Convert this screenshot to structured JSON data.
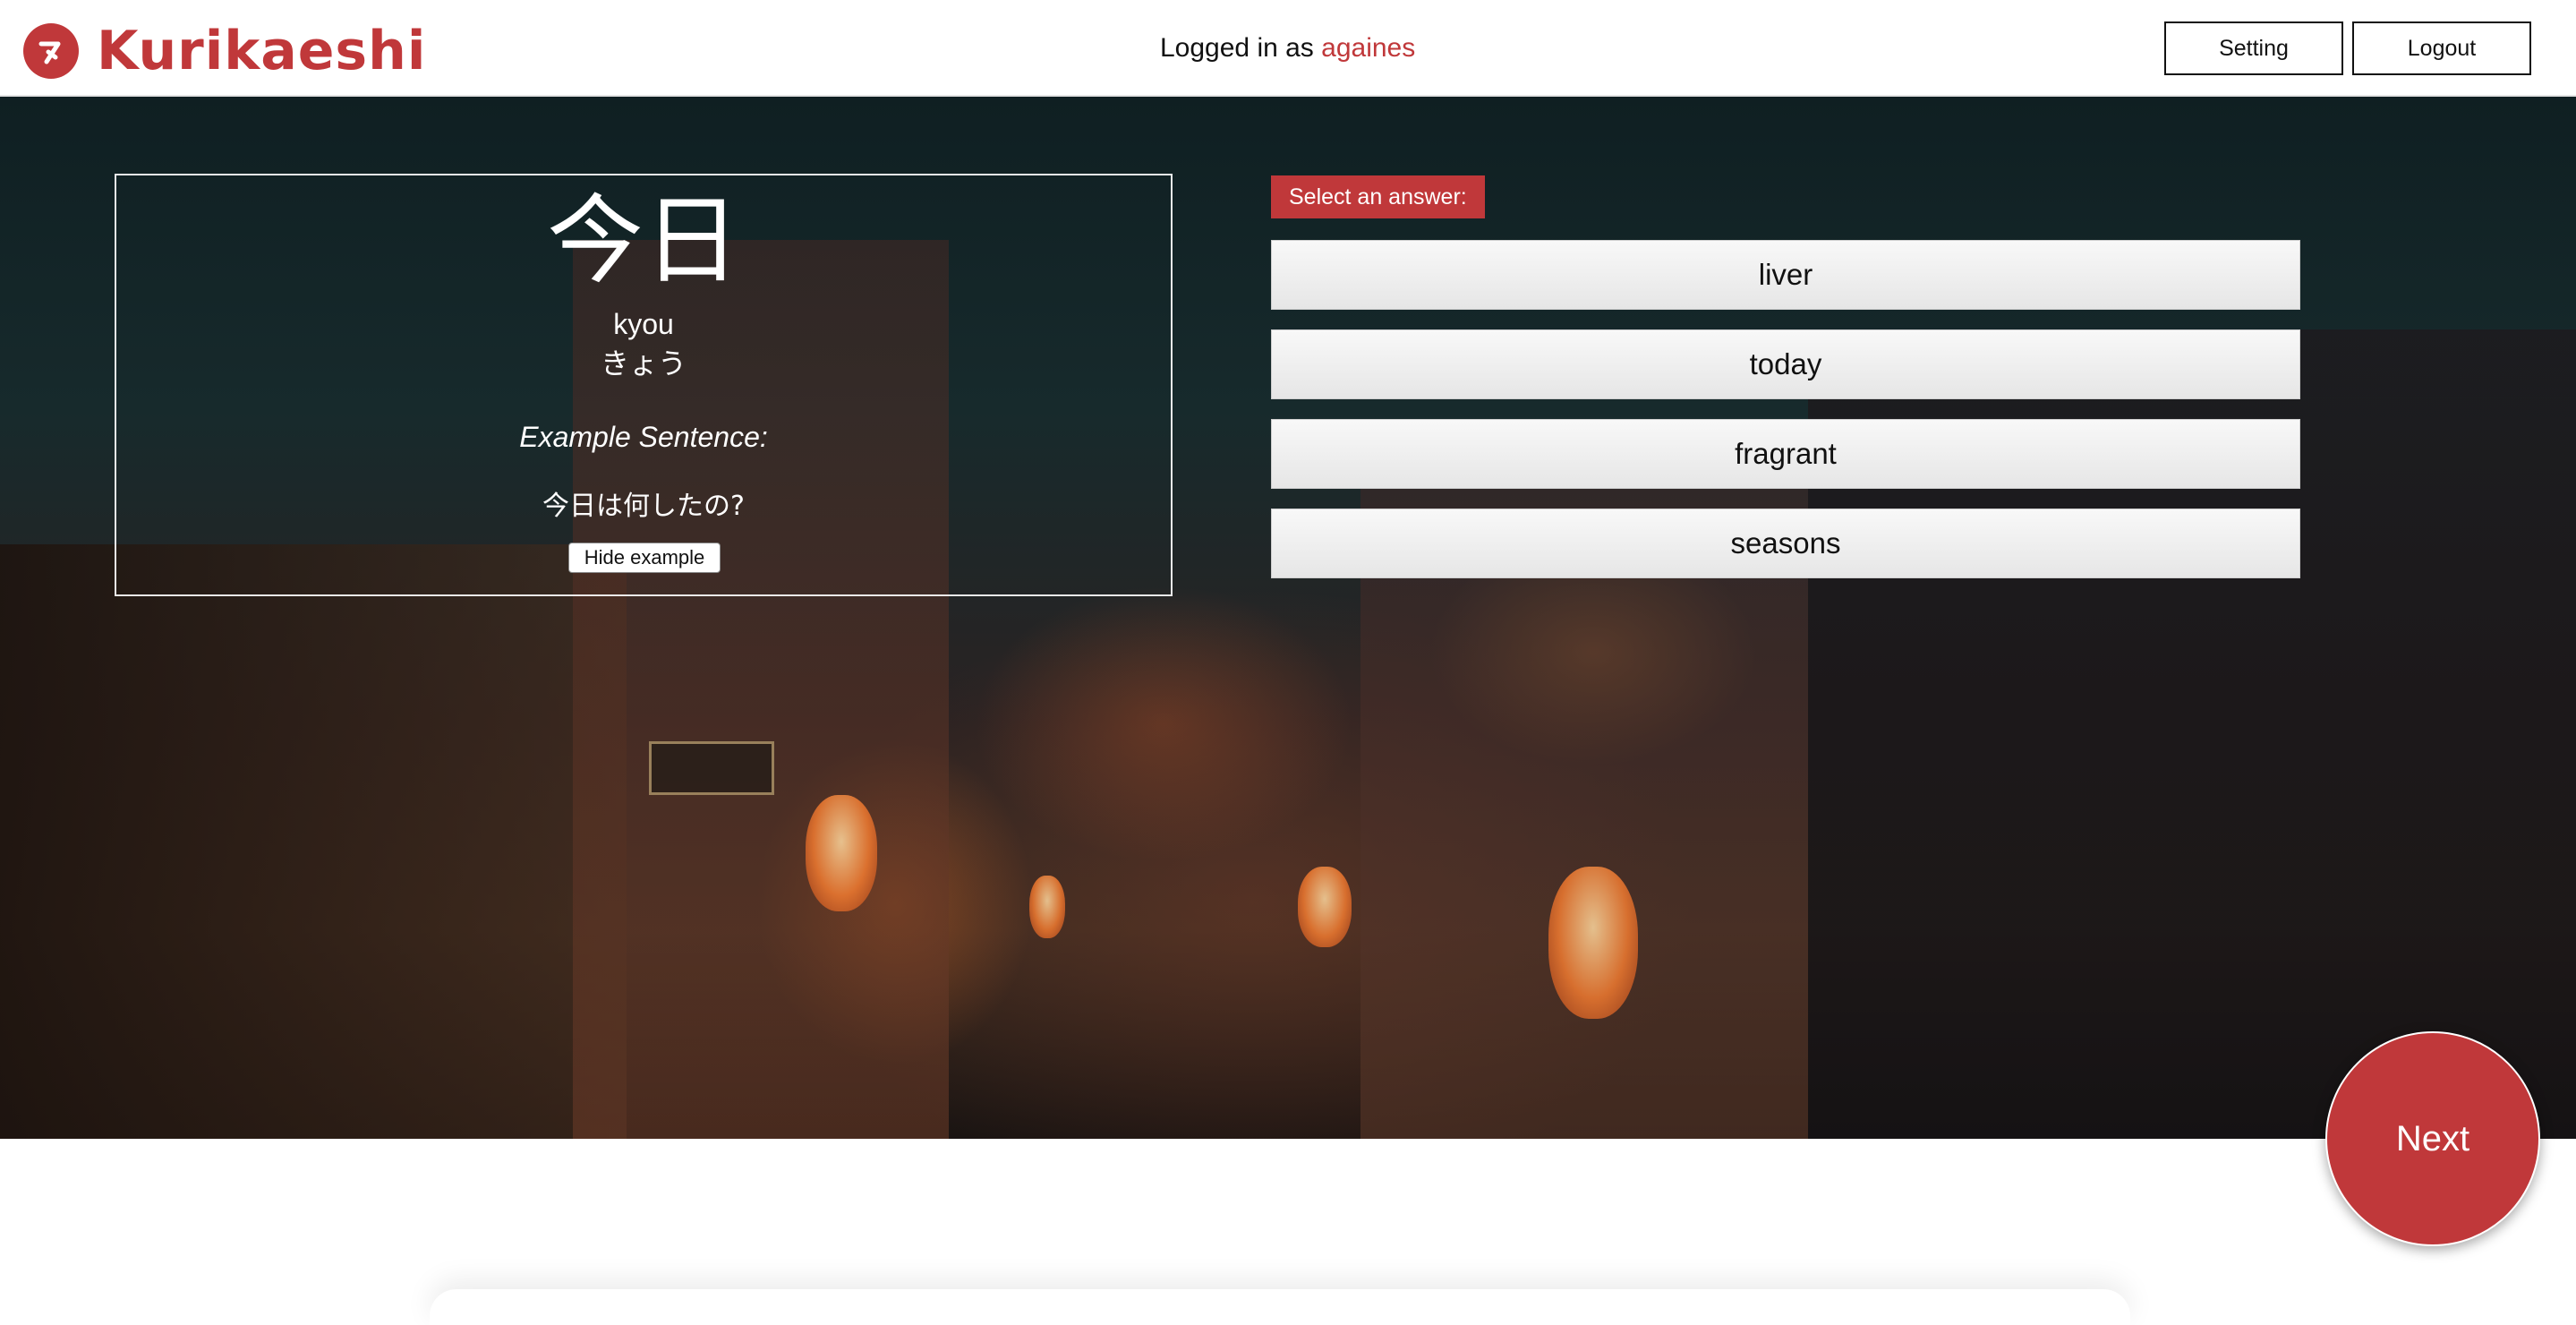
{
  "header": {
    "logo_text": "Kurikaeshi",
    "logged_in_prefix": "Logged in as",
    "username": "againes",
    "setting_label": "Setting",
    "logout_label": "Logout"
  },
  "card": {
    "kanji": "今日",
    "romaji": "kyou",
    "kana": "きょう",
    "example_heading": "Example Sentence:",
    "example_sentence": "今日は何したの?",
    "hide_example_label": "Hide example"
  },
  "quiz": {
    "prompt": "Select an answer:",
    "answers": [
      "liver",
      "today",
      "fragrant",
      "seasons"
    ]
  },
  "next_label": "Next",
  "colors": {
    "accent": "#c0383a",
    "answer_bg": "#eeeeee",
    "header_bg": "#ffffff"
  }
}
